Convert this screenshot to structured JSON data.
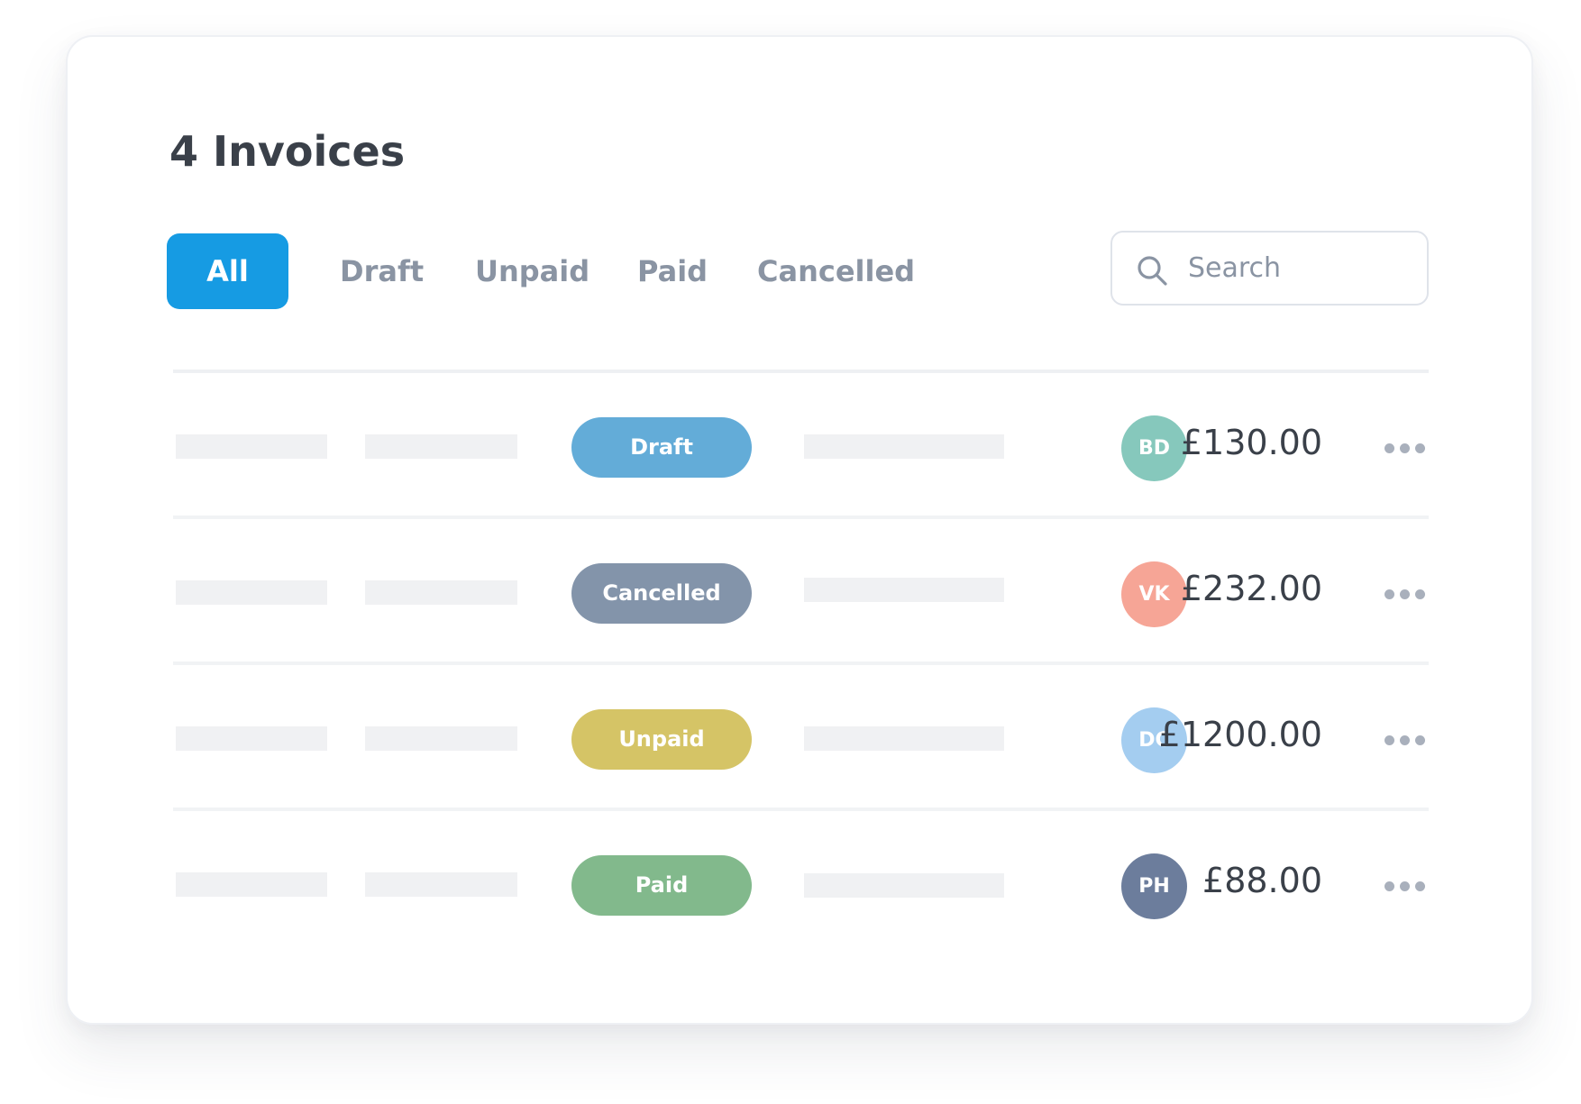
{
  "header": {
    "title": "4 Invoices"
  },
  "tabs": [
    {
      "label": "All",
      "active": true
    },
    {
      "label": "Draft",
      "active": false
    },
    {
      "label": "Unpaid",
      "active": false
    },
    {
      "label": "Paid",
      "active": false
    },
    {
      "label": "Cancelled",
      "active": false
    }
  ],
  "search": {
    "placeholder": "Search",
    "value": ""
  },
  "colors": {
    "accent": "#169be3",
    "draft": "#63acd8",
    "cancelled": "#8394aa",
    "unpaid": "#d5c466",
    "paid": "#82b98c"
  },
  "invoices": [
    {
      "status": "Draft",
      "status_color": "#63acd8",
      "initials": "BD",
      "avatar_color": "#86c8bc",
      "amount": "£130.00"
    },
    {
      "status": "Cancelled",
      "status_color": "#8394aa",
      "initials": "VK",
      "avatar_color": "#f6a596",
      "amount": "£232.00"
    },
    {
      "status": "Unpaid",
      "status_color": "#d5c466",
      "initials": "DC",
      "avatar_color": "#a4cdf0",
      "amount": "£1200.00"
    },
    {
      "status": "Paid",
      "status_color": "#82b98c",
      "initials": "PH",
      "avatar_color": "#6c7d9c",
      "amount": "£88.00"
    }
  ]
}
